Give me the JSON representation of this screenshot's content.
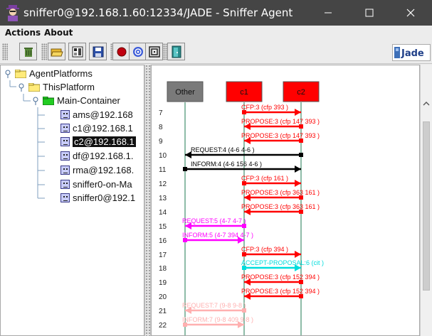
{
  "window": {
    "title": "sniffer0@192.168.1.60:12334/JADE - Sniffer Agent",
    "minimize_icon": "minimize-icon",
    "maximize_icon": "maximize-icon",
    "close_icon": "close-icon"
  },
  "menubar": {
    "actions_label": "Actions",
    "about_label": "About"
  },
  "toolbar": {
    "buttons": [
      "trash-icon",
      "open-folder-icon",
      "open-snapshot-icon",
      "save-icon",
      "record-icon",
      "filter-icon",
      "focus-icon",
      "exit-door-icon"
    ],
    "logo_text": "Jade"
  },
  "tree": {
    "root": "AgentPlatforms",
    "platform": "ThisPlatform",
    "container": "Main-Container",
    "agents": [
      "ams@192.168",
      "c1@192.168.1",
      "c2@192.168.1",
      "df@192.168.1.",
      "rma@192.168.",
      "sniffer0-on-Ma",
      "sniffer0@192.1"
    ],
    "selected_agent": "c2@192.168.1"
  },
  "sniffer": {
    "lifelines": [
      {
        "name": "Other",
        "color": "#7a7a7a"
      },
      {
        "name": "c1",
        "color": "#ff0000"
      },
      {
        "name": "c2",
        "color": "#ff0000"
      }
    ],
    "colors": {
      "red": "#ff0000",
      "black": "#000000",
      "magenta": "#ff00ff",
      "cyan": "#00dddd",
      "faded": "#ffb0b0",
      "lifeline": "#1e7a50"
    },
    "messages": [
      {
        "n": "7",
        "label": "CFP:3 (cfp  393  )",
        "from": "c1",
        "to": "c2",
        "color": "red"
      },
      {
        "n": "8",
        "label": "PROPOSE:3 (cfp  147  393 )",
        "from": "c2",
        "to": "c1",
        "color": "red"
      },
      {
        "n": "9",
        "label": "PROPOSE:3 (cfp  147  393 )",
        "from": "c2",
        "to": "c1",
        "color": "red"
      },
      {
        "n": "10",
        "label": "REQUEST:4 (4-6  4-6  )",
        "from": "c2",
        "to": "Other",
        "color": "black"
      },
      {
        "n": "11",
        "label": "INFORM:4 (4-6  156  4-6 )",
        "from": "Other",
        "to": "c2",
        "color": "black"
      },
      {
        "n": "12",
        "label": "CFP:3 (cfp  161  )",
        "from": "c1",
        "to": "c2",
        "color": "red"
      },
      {
        "n": "13",
        "label": "PROPOSE:3 (cfp  363  161 )",
        "from": "c2",
        "to": "c1",
        "color": "red"
      },
      {
        "n": "14",
        "label": "PROPOSE:3 (cfp  363  161 )",
        "from": "c2",
        "to": "c1",
        "color": "red"
      },
      {
        "n": "15",
        "label": "REQUEST:5 (4-7  4-7  )",
        "from": "c1",
        "to": "Other",
        "color": "magenta"
      },
      {
        "n": "16",
        "label": "INFORM:5 (4-7  394  4-7 )",
        "from": "Other",
        "to": "c1",
        "color": "magenta"
      },
      {
        "n": "17",
        "label": "CFP:3 (cfp  394  )",
        "from": "c1",
        "to": "c2",
        "color": "red"
      },
      {
        "n": "18",
        "label": "ACCEPT-PROPOSAL:6 (cit      )",
        "from": "c1",
        "to": "c2",
        "color": "cyan"
      },
      {
        "n": "19",
        "label": "PROPOSE:3 (cfp  152  394 )",
        "from": "c2",
        "to": "c1",
        "color": "red"
      },
      {
        "n": "20",
        "label": "PROPOSE:3 (cfp  152  394 )",
        "from": "c2",
        "to": "c1",
        "color": "red"
      },
      {
        "n": "21",
        "label": "REQUEST:7 (9-8  9-8  )",
        "from": "c1",
        "to": "Other",
        "color": "faded"
      },
      {
        "n": "22",
        "label": "INFORM:7 (9-8  409  9-8 )",
        "from": "Other",
        "to": "c1",
        "color": "faded"
      }
    ]
  }
}
